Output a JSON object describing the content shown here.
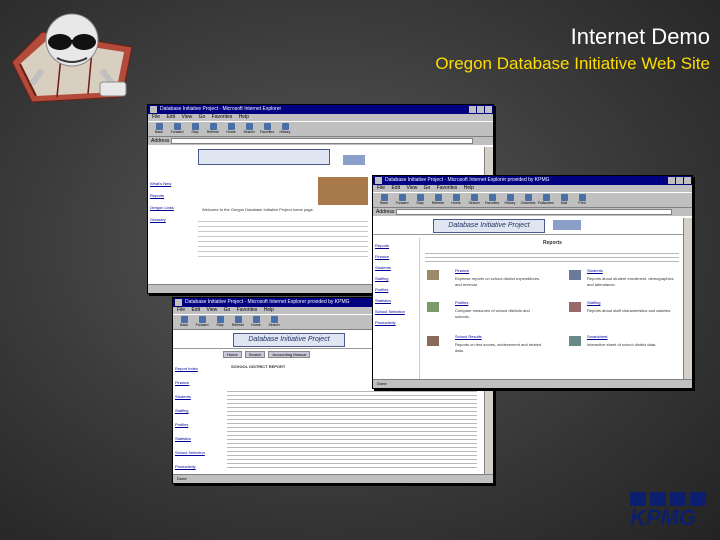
{
  "slide": {
    "title": "Internet Demo",
    "subtitle": "Oregon Database Initiative Web Site"
  },
  "brand": {
    "logo_text": "KPMG",
    "logo_color": "#0b1f6e"
  },
  "colors": {
    "title": "#ffffff",
    "subtitle": "#ffdd00",
    "background": "#3a3a3a",
    "window_title_bar": "#000080"
  },
  "windows": [
    {
      "title": "Database Initiative Project - Microsoft Internet Explorer",
      "menu": [
        "File",
        "Edit",
        "View",
        "Go",
        "Favorites",
        "Help"
      ],
      "toolbar": [
        "Back",
        "Forward",
        "Stop",
        "Refresh",
        "Home",
        "Search",
        "Favorites",
        "History",
        "Channels",
        "Fullscreen",
        "Mail",
        "Print",
        "Edit"
      ],
      "sidebar": [
        "What's New",
        "Reports",
        "Oregon Links",
        "Glossary"
      ],
      "body_text": "Welcome to the Oregon Database Initiative Project home page."
    },
    {
      "title": "Database Initiative Project - Microsoft Internet Explorer provided by KPMG",
      "menu": [
        "File",
        "Edit",
        "View",
        "Go",
        "Favorites",
        "Help"
      ],
      "toolbar": [
        "Back",
        "Forward",
        "Stop",
        "Refresh",
        "Home",
        "Search",
        "Favorites",
        "History",
        "Channels",
        "Fullscreen",
        "Mail",
        "Print"
      ],
      "banner": "Database Initiative Project",
      "sidebar": [
        "Reports",
        "Finance",
        "Students",
        "Staffing",
        "Profiles",
        "Statistics",
        "School Selection",
        "Productivity",
        "Reports"
      ],
      "section_title": "Reports",
      "report_tiles": [
        {
          "label": "Finance",
          "desc": "Expense reports on school district expenditures, and revenue."
        },
        {
          "label": "Students",
          "desc": "Reports about student enrollment, demographics and attendance."
        },
        {
          "label": "Profiles",
          "desc": "Compare measures of school districts and schools."
        },
        {
          "label": "Staffing",
          "desc": "Reports about staff characteristics and salaries."
        },
        {
          "label": "School Results",
          "desc": "Reports on test scores, achievement and related data."
        },
        {
          "label": "Smartsheet",
          "desc": "Interactive sheet of school district data."
        }
      ],
      "status": "Done"
    },
    {
      "title": "Database Initiative Project - Microsoft Internet Explorer provided by KPMG",
      "menu": [
        "File",
        "Edit",
        "View",
        "Go",
        "Favorites",
        "Help"
      ],
      "toolbar": [
        "Back",
        "Forward",
        "Stop",
        "Refresh",
        "Home",
        "Search",
        "Favorites",
        "History",
        "Channels",
        "Fullscreen",
        "Mail",
        "Print"
      ],
      "banner": "Database Initiative Project",
      "nav": [
        "Home",
        "Search",
        "Accounting Manual"
      ],
      "sidebar": [
        "Report Index",
        "Finance",
        "Students",
        "Staffing",
        "Profiles",
        "Statistics",
        "School Selection",
        "Productivity"
      ],
      "report_header": "SCHOOL DISTRICT REPORT",
      "status": "Done"
    }
  ]
}
